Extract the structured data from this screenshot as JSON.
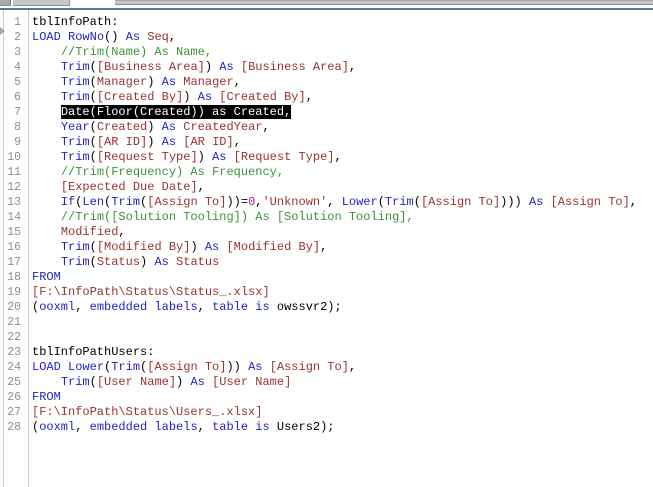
{
  "chrome": {
    "divider_color": "#4c7aa0",
    "toolbar_gray": "#c7c7c7"
  },
  "colors": {
    "keyword": "#2323cb",
    "field": "#9a3232",
    "comment": "#3a923a",
    "number": "#a020a0",
    "string": "#9a3232",
    "plain": "#000000",
    "selection_bg": "#000000",
    "selection_fg": "#ffffff",
    "line_number": "#8a8f96"
  },
  "editor": {
    "lines": [
      {
        "n": "1",
        "tokens": [
          {
            "t": "tblInfoPath:",
            "c": "p"
          }
        ]
      },
      {
        "n": "2",
        "tokens": [
          {
            "t": "LOAD",
            "c": "k"
          },
          {
            "t": " ",
            "c": "p"
          },
          {
            "t": "RowNo",
            "c": "k"
          },
          {
            "t": "() ",
            "c": "p"
          },
          {
            "t": "As",
            "c": "k"
          },
          {
            "t": " ",
            "c": "p"
          },
          {
            "t": "Seq",
            "c": "f"
          },
          {
            "t": ",",
            "c": "p"
          }
        ]
      },
      {
        "n": "3",
        "tokens": [
          {
            "t": "    ",
            "c": "p"
          },
          {
            "t": "//Trim(Name) As Name,",
            "c": "c"
          }
        ]
      },
      {
        "n": "4",
        "tokens": [
          {
            "t": "    ",
            "c": "p"
          },
          {
            "t": "Trim",
            "c": "k"
          },
          {
            "t": "(",
            "c": "p"
          },
          {
            "t": "[Business Area]",
            "c": "f"
          },
          {
            "t": ") ",
            "c": "p"
          },
          {
            "t": "As",
            "c": "k"
          },
          {
            "t": " ",
            "c": "p"
          },
          {
            "t": "[Business Area]",
            "c": "f"
          },
          {
            "t": ",",
            "c": "p"
          }
        ]
      },
      {
        "n": "5",
        "tokens": [
          {
            "t": "    ",
            "c": "p"
          },
          {
            "t": "Trim",
            "c": "k"
          },
          {
            "t": "(",
            "c": "p"
          },
          {
            "t": "Manager",
            "c": "f"
          },
          {
            "t": ") ",
            "c": "p"
          },
          {
            "t": "As",
            "c": "k"
          },
          {
            "t": " ",
            "c": "p"
          },
          {
            "t": "Manager",
            "c": "f"
          },
          {
            "t": ",",
            "c": "p"
          }
        ]
      },
      {
        "n": "6",
        "tokens": [
          {
            "t": "    ",
            "c": "p"
          },
          {
            "t": "Trim",
            "c": "k"
          },
          {
            "t": "(",
            "c": "p"
          },
          {
            "t": "[Created By]",
            "c": "f"
          },
          {
            "t": ") ",
            "c": "p"
          },
          {
            "t": "As",
            "c": "k"
          },
          {
            "t": " ",
            "c": "p"
          },
          {
            "t": "[Created By]",
            "c": "f"
          },
          {
            "t": ",",
            "c": "p"
          }
        ]
      },
      {
        "n": "7",
        "tokens": [
          {
            "t": "    ",
            "c": "p"
          },
          {
            "t": "Date(Floor(Created)) as Created,",
            "c": "sel"
          }
        ]
      },
      {
        "n": "8",
        "tokens": [
          {
            "t": "    ",
            "c": "p"
          },
          {
            "t": "Year",
            "c": "k"
          },
          {
            "t": "(",
            "c": "p"
          },
          {
            "t": "Created",
            "c": "f"
          },
          {
            "t": ") ",
            "c": "p"
          },
          {
            "t": "As",
            "c": "k"
          },
          {
            "t": " ",
            "c": "p"
          },
          {
            "t": "CreatedYear",
            "c": "f"
          },
          {
            "t": ",",
            "c": "p"
          }
        ]
      },
      {
        "n": "9",
        "tokens": [
          {
            "t": "    ",
            "c": "p"
          },
          {
            "t": "Trim",
            "c": "k"
          },
          {
            "t": "(",
            "c": "p"
          },
          {
            "t": "[AR ID]",
            "c": "f"
          },
          {
            "t": ") ",
            "c": "p"
          },
          {
            "t": "As",
            "c": "k"
          },
          {
            "t": " ",
            "c": "p"
          },
          {
            "t": "[AR ID]",
            "c": "f"
          },
          {
            "t": ",",
            "c": "p"
          }
        ]
      },
      {
        "n": "10",
        "tokens": [
          {
            "t": "    ",
            "c": "p"
          },
          {
            "t": "Trim",
            "c": "k"
          },
          {
            "t": "(",
            "c": "p"
          },
          {
            "t": "[Request Type]",
            "c": "f"
          },
          {
            "t": ") ",
            "c": "p"
          },
          {
            "t": "As",
            "c": "k"
          },
          {
            "t": " ",
            "c": "p"
          },
          {
            "t": "[Request Type]",
            "c": "f"
          },
          {
            "t": ",",
            "c": "p"
          }
        ]
      },
      {
        "n": "11",
        "tokens": [
          {
            "t": "    ",
            "c": "p"
          },
          {
            "t": "//Trim(Frequency) As Frequency,",
            "c": "c"
          }
        ]
      },
      {
        "n": "12",
        "tokens": [
          {
            "t": "    ",
            "c": "p"
          },
          {
            "t": "[Expected Due Date]",
            "c": "f"
          },
          {
            "t": ",",
            "c": "p"
          }
        ]
      },
      {
        "n": "13",
        "tokens": [
          {
            "t": "    ",
            "c": "p"
          },
          {
            "t": "If",
            "c": "k"
          },
          {
            "t": "(",
            "c": "p"
          },
          {
            "t": "Len",
            "c": "k"
          },
          {
            "t": "(",
            "c": "p"
          },
          {
            "t": "Trim",
            "c": "k"
          },
          {
            "t": "(",
            "c": "p"
          },
          {
            "t": "[Assign To]",
            "c": "f"
          },
          {
            "t": "))=",
            "c": "p"
          },
          {
            "t": "0",
            "c": "n"
          },
          {
            "t": ",",
            "c": "p"
          },
          {
            "t": "'Unknown'",
            "c": "s"
          },
          {
            "t": ", ",
            "c": "p"
          },
          {
            "t": "Lower",
            "c": "k"
          },
          {
            "t": "(",
            "c": "p"
          },
          {
            "t": "Trim",
            "c": "k"
          },
          {
            "t": "(",
            "c": "p"
          },
          {
            "t": "[Assign To]",
            "c": "f"
          },
          {
            "t": "))) ",
            "c": "p"
          },
          {
            "t": "As",
            "c": "k"
          },
          {
            "t": " ",
            "c": "p"
          },
          {
            "t": "[Assign To]",
            "c": "f"
          },
          {
            "t": ",",
            "c": "p"
          }
        ]
      },
      {
        "n": "14",
        "tokens": [
          {
            "t": "    ",
            "c": "p"
          },
          {
            "t": "//Trim([Solution Tooling]) As [Solution Tooling],",
            "c": "c"
          }
        ]
      },
      {
        "n": "15",
        "tokens": [
          {
            "t": "    ",
            "c": "p"
          },
          {
            "t": "Modified",
            "c": "f"
          },
          {
            "t": ",",
            "c": "p"
          }
        ]
      },
      {
        "n": "16",
        "tokens": [
          {
            "t": "    ",
            "c": "p"
          },
          {
            "t": "Trim",
            "c": "k"
          },
          {
            "t": "(",
            "c": "p"
          },
          {
            "t": "[Modified By]",
            "c": "f"
          },
          {
            "t": ") ",
            "c": "p"
          },
          {
            "t": "As",
            "c": "k"
          },
          {
            "t": " ",
            "c": "p"
          },
          {
            "t": "[Modified By]",
            "c": "f"
          },
          {
            "t": ",",
            "c": "p"
          }
        ]
      },
      {
        "n": "17",
        "tokens": [
          {
            "t": "    ",
            "c": "p"
          },
          {
            "t": "Trim",
            "c": "k"
          },
          {
            "t": "(",
            "c": "p"
          },
          {
            "t": "Status",
            "c": "f"
          },
          {
            "t": ") ",
            "c": "p"
          },
          {
            "t": "As",
            "c": "k"
          },
          {
            "t": " ",
            "c": "p"
          },
          {
            "t": "Status",
            "c": "f"
          }
        ]
      },
      {
        "n": "18",
        "tokens": [
          {
            "t": "FROM",
            "c": "k"
          }
        ]
      },
      {
        "n": "19",
        "tokens": [
          {
            "t": "[F:\\InfoPath\\Status\\Status_.xlsx]",
            "c": "f"
          }
        ]
      },
      {
        "n": "20",
        "tokens": [
          {
            "t": "(",
            "c": "p"
          },
          {
            "t": "ooxml",
            "c": "k"
          },
          {
            "t": ", ",
            "c": "p"
          },
          {
            "t": "embedded",
            "c": "k"
          },
          {
            "t": " ",
            "c": "p"
          },
          {
            "t": "labels",
            "c": "k"
          },
          {
            "t": ", ",
            "c": "p"
          },
          {
            "t": "table",
            "c": "k"
          },
          {
            "t": " ",
            "c": "p"
          },
          {
            "t": "is",
            "c": "k"
          },
          {
            "t": " owssvr2);",
            "c": "p"
          }
        ]
      },
      {
        "n": "21",
        "tokens": []
      },
      {
        "n": "22",
        "tokens": []
      },
      {
        "n": "23",
        "tokens": [
          {
            "t": "tblInfoPathUsers:",
            "c": "p"
          }
        ]
      },
      {
        "n": "24",
        "tokens": [
          {
            "t": "LOAD",
            "c": "k"
          },
          {
            "t": " ",
            "c": "p"
          },
          {
            "t": "Lower",
            "c": "k"
          },
          {
            "t": "(",
            "c": "p"
          },
          {
            "t": "Trim",
            "c": "k"
          },
          {
            "t": "(",
            "c": "p"
          },
          {
            "t": "[Assign To]",
            "c": "f"
          },
          {
            "t": ")) ",
            "c": "p"
          },
          {
            "t": "As",
            "c": "k"
          },
          {
            "t": " ",
            "c": "p"
          },
          {
            "t": "[Assign To]",
            "c": "f"
          },
          {
            "t": ",",
            "c": "p"
          }
        ]
      },
      {
        "n": "25",
        "tokens": [
          {
            "t": "    ",
            "c": "p"
          },
          {
            "t": "Trim",
            "c": "k"
          },
          {
            "t": "(",
            "c": "p"
          },
          {
            "t": "[User Name]",
            "c": "f"
          },
          {
            "t": ") ",
            "c": "p"
          },
          {
            "t": "As",
            "c": "k"
          },
          {
            "t": " ",
            "c": "p"
          },
          {
            "t": "[User Name]",
            "c": "f"
          }
        ]
      },
      {
        "n": "26",
        "tokens": [
          {
            "t": "FROM",
            "c": "k"
          }
        ]
      },
      {
        "n": "27",
        "tokens": [
          {
            "t": "[F:\\InfoPath\\Status\\Users_.xlsx]",
            "c": "f"
          }
        ]
      },
      {
        "n": "28",
        "tokens": [
          {
            "t": "(",
            "c": "p"
          },
          {
            "t": "ooxml",
            "c": "k"
          },
          {
            "t": ", ",
            "c": "p"
          },
          {
            "t": "embedded",
            "c": "k"
          },
          {
            "t": " ",
            "c": "p"
          },
          {
            "t": "labels",
            "c": "k"
          },
          {
            "t": ", ",
            "c": "p"
          },
          {
            "t": "table",
            "c": "k"
          },
          {
            "t": " ",
            "c": "p"
          },
          {
            "t": "is",
            "c": "k"
          },
          {
            "t": " Users2);",
            "c": "p"
          }
        ]
      }
    ]
  }
}
